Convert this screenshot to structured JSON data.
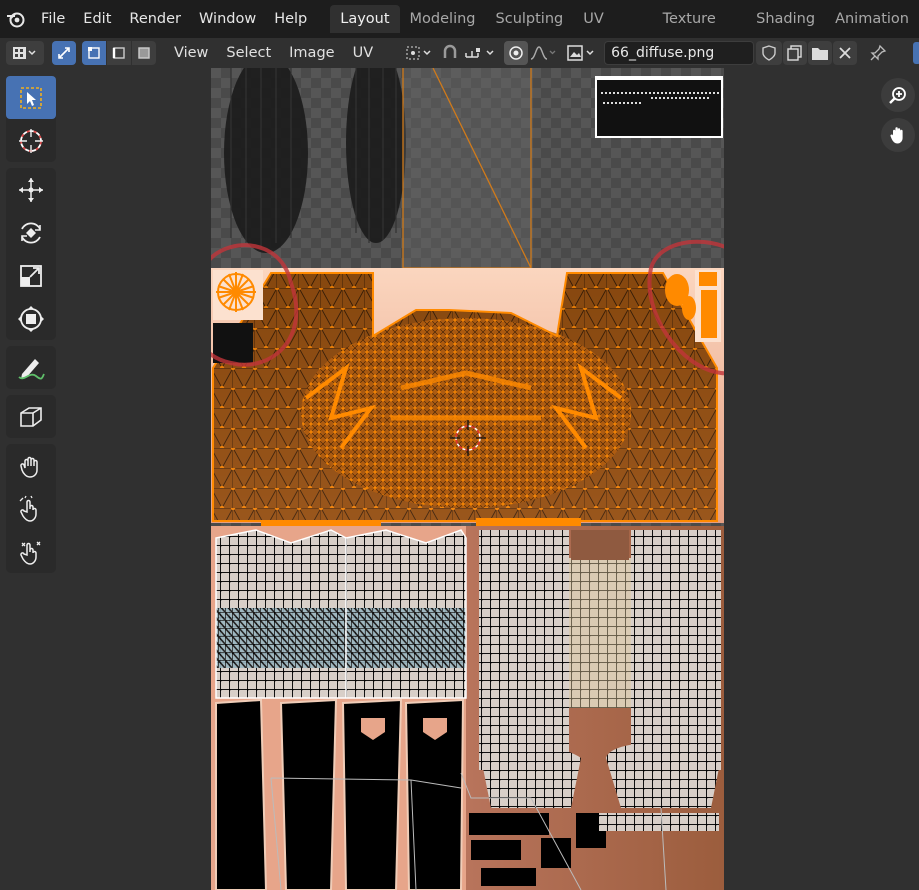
{
  "menubar": {
    "menus": [
      "File",
      "Edit",
      "Render",
      "Window",
      "Help"
    ],
    "workspace_tabs": [
      "Layout",
      "Modeling",
      "Sculpting",
      "UV Editing",
      "Texture Paint",
      "Shading",
      "Animation"
    ],
    "active_tab": "Layout"
  },
  "header": {
    "menus": [
      "View",
      "Select",
      "Image",
      "UV"
    ],
    "image_name": "66_diffuse.png"
  },
  "toolbar": {
    "tools": [
      "select-box",
      "cursor",
      "move",
      "rotate",
      "scale",
      "transform",
      "annotate",
      "rip",
      "grab",
      "relax",
      "pinch"
    ],
    "active_tool": "select-box"
  },
  "colors": {
    "accent": "#4772b3",
    "uv_orange": "#ff8a00",
    "annotation_red": "#c0353a",
    "skin": "#e8a184"
  }
}
